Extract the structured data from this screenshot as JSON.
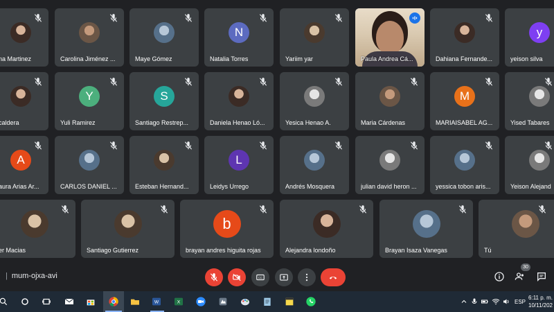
{
  "meeting": {
    "code": "mum-ojxa-avi",
    "participant_count": "30"
  },
  "participants": [
    {
      "name": "na Martinez"
    },
    {
      "name": "Carolina Jiménez ..."
    },
    {
      "name": "Maye Gómez"
    },
    {
      "name": "Natalia Torres",
      "initial": "N",
      "color": "#5c6bc0"
    },
    {
      "name": "Yariim yar"
    },
    {
      "name": "Paula Andrea Cá..."
    },
    {
      "name": "Dahiana Fernande..."
    },
    {
      "name": "yeison silva",
      "initial": "y",
      "color": "#7e3ff2"
    },
    {
      "name": "caldera"
    },
    {
      "name": "Yuli Ramirez",
      "initial": "Y",
      "color": "#4caf7d"
    },
    {
      "name": "Santiago Restrep...",
      "initial": "S",
      "color": "#26a69a"
    },
    {
      "name": "Daniela Henao Ló..."
    },
    {
      "name": "Yesica Henao A."
    },
    {
      "name": "Maria Cárdenas"
    },
    {
      "name": "MARIAISABEL AG...",
      "initial": "M",
      "color": "#e8711a"
    },
    {
      "name": "Yised Tabares"
    },
    {
      "name": "aura Arias Ar...",
      "initial": "A",
      "color": "#e64a19"
    },
    {
      "name": "CARLOS DANIEL ..."
    },
    {
      "name": "Esteban Hernand..."
    },
    {
      "name": "Leidys Urrego",
      "initial": "L",
      "color": "#5e35b1"
    },
    {
      "name": "Andrés Mosquera"
    },
    {
      "name": "julian david heron ..."
    },
    {
      "name": "yessica tobon aris..."
    },
    {
      "name": "Yeison Alejand"
    },
    {
      "name": "er Macias"
    },
    {
      "name": "Santiago Gutierrez"
    },
    {
      "name": "brayan andres higuita rojas",
      "initial": "b",
      "color": "#e64a19"
    },
    {
      "name": "Alejandra londoño"
    },
    {
      "name": "Brayan Isaza Vanegas"
    },
    {
      "name": "Tú"
    }
  ],
  "taskbar": {
    "language": "ESP",
    "time": "6:11 p. m.",
    "date": "10/11/202"
  },
  "colors": {
    "tile_bg": "#3c4043",
    "active_outline": "#8ab4f8",
    "danger": "#ea4335"
  },
  "icons": {
    "tile": "mic-off-icon",
    "speaking": "audio-level-icon",
    "controls": [
      "mic-off-icon",
      "camera-off-icon",
      "captions-icon",
      "present-icon",
      "more-icon",
      "hangup-icon"
    ],
    "right": [
      "info-icon",
      "people-icon",
      "chat-icon"
    ],
    "taskbar": [
      "search-icon",
      "cortana-icon",
      "task-view-icon",
      "mail-icon",
      "store-icon",
      "chrome-icon",
      "file-explorer-icon",
      "word-icon",
      "excel-icon",
      "zoom-icon",
      "app-icon",
      "paint-icon",
      "notepad-icon",
      "sticky-notes-icon",
      "whatsapp-icon"
    ]
  }
}
